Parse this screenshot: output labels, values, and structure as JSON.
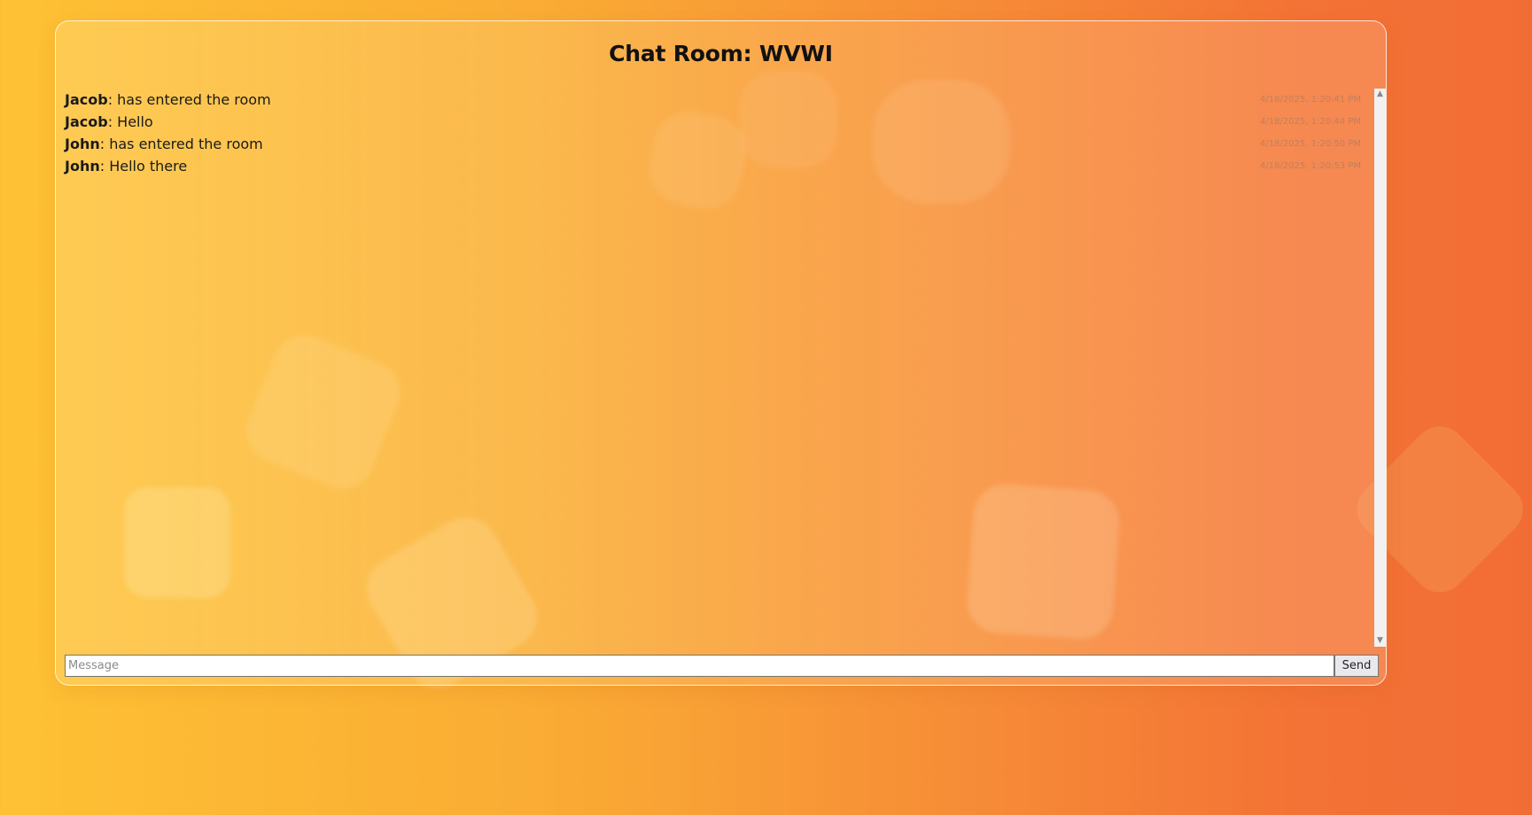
{
  "room": {
    "title": "Chat Room: WVWI"
  },
  "messages": [
    {
      "author": "Jacob",
      "text": ": has entered the room",
      "timestamp": "4/18/2025, 1:20:41 PM"
    },
    {
      "author": "Jacob",
      "text": ": Hello",
      "timestamp": "4/18/2025, 1:20:44 PM"
    },
    {
      "author": "John",
      "text": ": has entered the room",
      "timestamp": "4/18/2025, 1:20:50 PM"
    },
    {
      "author": "John",
      "text": ": Hello there",
      "timestamp": "4/18/2025, 1:20:53 PM"
    }
  ],
  "composer": {
    "placeholder": "Message",
    "value": "",
    "send_label": "Send"
  },
  "scrollbar": {
    "up_icon": "▲",
    "down_icon": "▼"
  },
  "colors": {
    "background_start": "#fec134",
    "background_end": "#f26d35",
    "text": "#1a1a1a"
  }
}
